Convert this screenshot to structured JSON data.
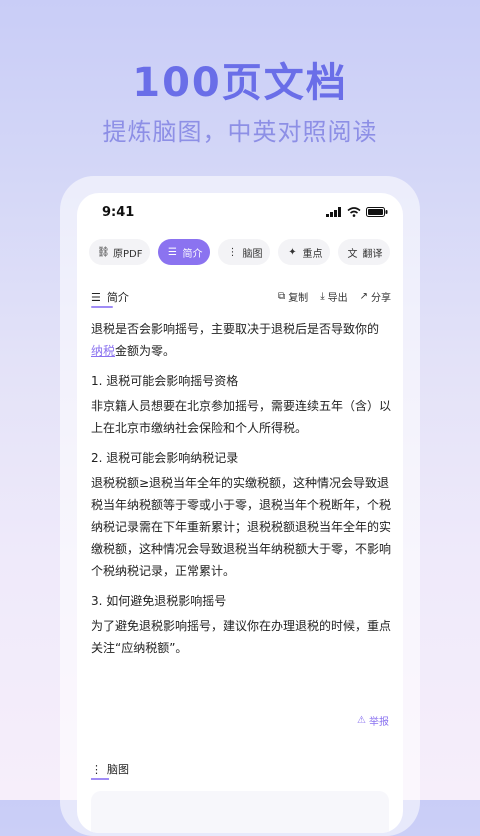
{
  "promo": {
    "headline": "100页文档",
    "subheadline": "提炼脑图，中英对照阅读"
  },
  "status_bar": {
    "time": "9:41"
  },
  "tabs": [
    {
      "label": "原PDF",
      "icon": "link-icon",
      "active": false
    },
    {
      "label": "简介",
      "icon": "summary-icon",
      "active": true
    },
    {
      "label": "脑图",
      "icon": "mindmap-icon",
      "active": false
    },
    {
      "label": "重点",
      "icon": "sparkle-icon",
      "active": false
    },
    {
      "label": "翻译",
      "icon": "translate-icon",
      "active": false
    }
  ],
  "section": {
    "title": "简介",
    "actions": {
      "copy": "复制",
      "export": "导出",
      "share": "分享"
    }
  },
  "content": {
    "intro_before": "退税是否会影响摇号，主要取决于退税后是否导致你的",
    "intro_link": "纳税",
    "intro_after": "金额为零。",
    "h1": "1. 退税可能会影响摇号资格",
    "p1": "非京籍人员想要在北京参加摇号，需要连续五年（含）以上在北京市缴纳社会保险和个人所得税。",
    "h2": "2. 退税可能会影响纳税记录",
    "p2": "退税税额≥退税当年全年的实缴税额，这种情况会导致退税当年纳税额等于零或小于零，退税当年个税断年，个税纳税记录需在下年重新累计；退税税额退税当年全年的实缴税额，这种情况会导致退税当年纳税额大于零，不影响个税纳税记录，正常累计。",
    "h3": "3. 如何避免退税影响摇号",
    "p3": "为了避免退税影响摇号，建议你在办理退税的时候，重点关注“应纳税额”。"
  },
  "report_label": "举报",
  "mindmap_section": {
    "title": "脑图"
  },
  "colors": {
    "accent": "#8b73f0",
    "headline": "#6a6ee8"
  }
}
